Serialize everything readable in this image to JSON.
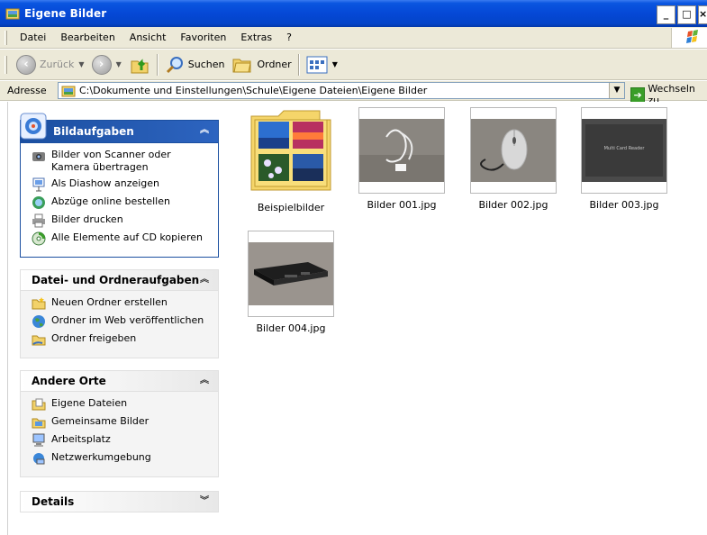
{
  "window": {
    "title": "Eigene Bilder",
    "buttons": [
      "_",
      "□",
      "×"
    ]
  },
  "menu": [
    "Datei",
    "Bearbeiten",
    "Ansicht",
    "Favoriten",
    "Extras",
    "?"
  ],
  "toolbar": {
    "back_label": "Zurück",
    "search_label": "Suchen",
    "folders_label": "Ordner"
  },
  "address": {
    "label": "Adresse",
    "path": "C:\\Dokumente und Einstellungen\\Schule\\Eigene Dateien\\Eigene Bilder",
    "go_label": "Wechseln zu"
  },
  "panels": {
    "picture_tasks": {
      "title": "Bildaufgaben",
      "items": [
        "Bilder von Scanner oder Kamera übertragen",
        "Als Diashow anzeigen",
        "Abzüge online bestellen",
        "Bilder drucken",
        "Alle Elemente auf CD kopieren"
      ]
    },
    "file_tasks": {
      "title": "Datei- und Ordneraufgaben",
      "items": [
        "Neuen Ordner erstellen",
        "Ordner im Web veröffentlichen",
        "Ordner freigeben"
      ]
    },
    "other_places": {
      "title": "Andere Orte",
      "items": [
        "Eigene Dateien",
        "Gemeinsame Bilder",
        "Arbeitsplatz",
        "Netzwerkumgebung"
      ]
    },
    "details": {
      "title": "Details"
    }
  },
  "files": [
    {
      "name": "Beispielbilder",
      "type": "folder"
    },
    {
      "name": "Bilder 001.jpg",
      "type": "image"
    },
    {
      "name": "Bilder 002.jpg",
      "type": "image"
    },
    {
      "name": "Bilder 003.jpg",
      "type": "image"
    },
    {
      "name": "Bilder 004.jpg",
      "type": "image"
    }
  ],
  "photo_text": {
    "card_reader_label": "Multi Card Reader"
  }
}
